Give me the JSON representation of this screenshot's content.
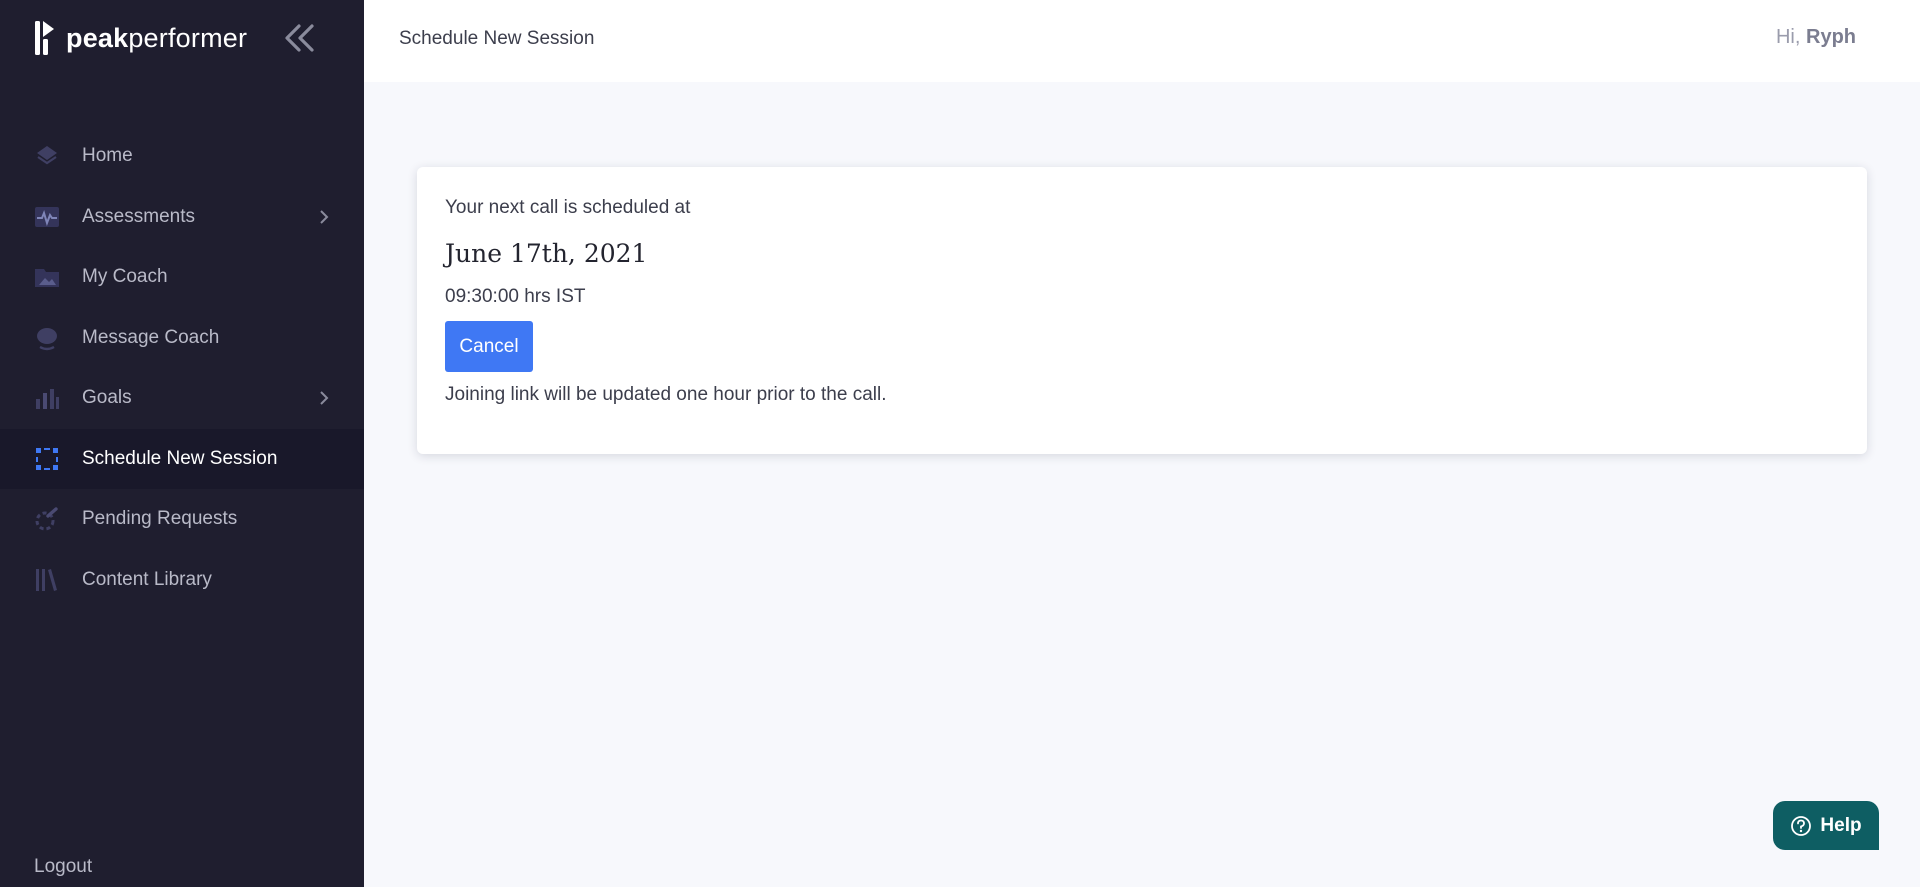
{
  "brand": {
    "bold": "peak",
    "rest": "performer"
  },
  "sidebar": {
    "items": [
      {
        "label": "Home",
        "icon": "home-icon",
        "has_submenu": false,
        "active": false
      },
      {
        "label": "Assessments",
        "icon": "pulse-icon",
        "has_submenu": true,
        "active": false
      },
      {
        "label": "My Coach",
        "icon": "folder-image-icon",
        "has_submenu": false,
        "active": false
      },
      {
        "label": "Message Coach",
        "icon": "chat-bubble-icon",
        "has_submenu": false,
        "active": false
      },
      {
        "label": "Goals",
        "icon": "bar-chart-icon",
        "has_submenu": true,
        "active": false
      },
      {
        "label": "Schedule New Session",
        "icon": "schedule-grid-icon",
        "has_submenu": false,
        "active": true
      },
      {
        "label": "Pending Requests",
        "icon": "pending-icon",
        "has_submenu": false,
        "active": false
      },
      {
        "label": "Content Library",
        "icon": "library-icon",
        "has_submenu": false,
        "active": false
      }
    ],
    "logout_label": "Logout"
  },
  "header": {
    "title": "Schedule New Session",
    "greeting_prefix": "Hi,",
    "user_name": "Ryph"
  },
  "session": {
    "intro": "Your next call is scheduled at",
    "date": "June 17th, 2021",
    "time": "09:30:00 hrs IST",
    "cancel_label": "Cancel",
    "note": "Joining link will be updated one hour prior to the call."
  },
  "help": {
    "label": "Help"
  },
  "colors": {
    "sidebar_bg": "#1f1e2f",
    "active_item_bg": "#19182a",
    "accent_blue": "#3f78f4",
    "help_bg": "#0e5e63",
    "page_bg": "#f7f8fc"
  }
}
